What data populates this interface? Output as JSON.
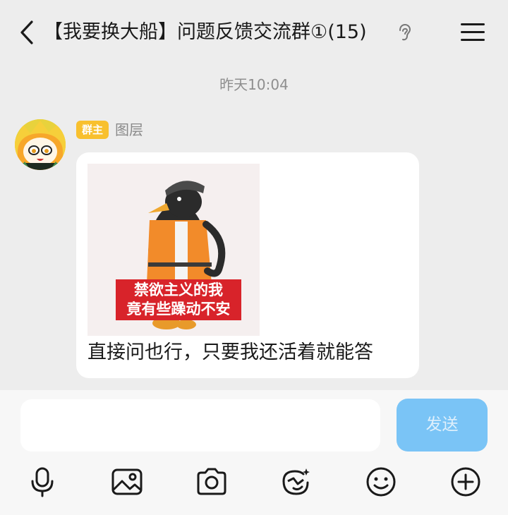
{
  "header": {
    "title": "【我要换大船】问题反馈交流群①(15)",
    "back_icon": "chevron-left-icon",
    "ear_icon": "ear-icon",
    "menu_icon": "hamburger-menu-icon"
  },
  "chat": {
    "timestamp": "昨天10:04",
    "message": {
      "role_badge": "群主",
      "sender": "图层",
      "sticker_caption_line1": "禁欲主义的我",
      "sticker_caption_line2": "竟有些躁动不安",
      "text": "直接问也行，只要我还活着就能答"
    }
  },
  "composer": {
    "input_value": "",
    "send_label": "发送",
    "toolbar_icons": [
      "microphone-icon",
      "image-icon",
      "camera-icon",
      "sticker-icon",
      "emoji-icon",
      "plus-icon"
    ]
  },
  "colors": {
    "background": "#ededed",
    "bubble": "#ffffff",
    "badge": "#f8c02e",
    "send_button": "#7ac4f6"
  }
}
